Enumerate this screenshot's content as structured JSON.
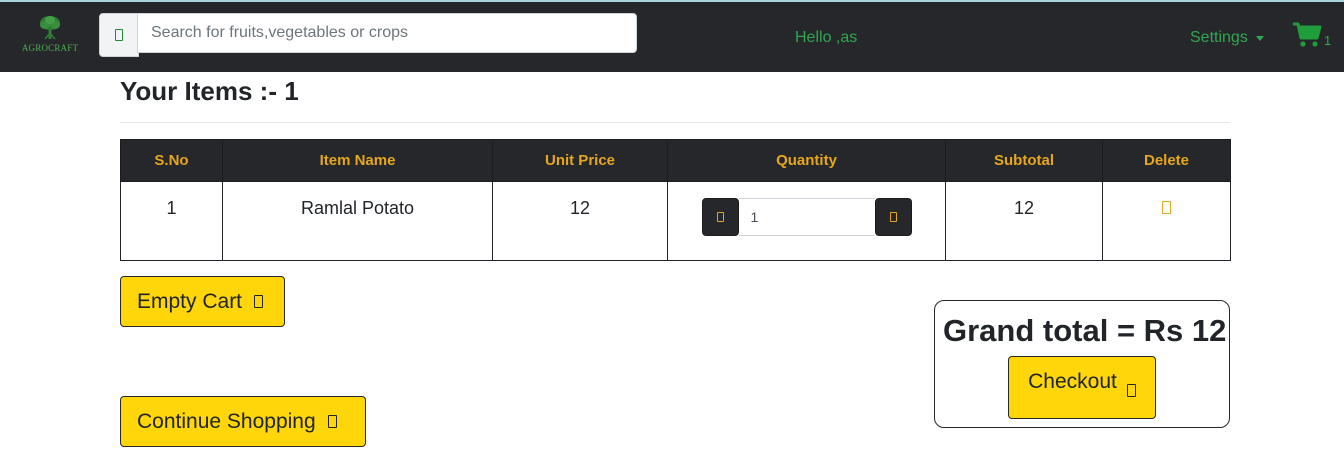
{
  "brand": {
    "name": "AGROCRAFT"
  },
  "search": {
    "placeholder": "Search for fruits,vegetables or crops",
    "icon": "search-icon"
  },
  "nav": {
    "greeting": "Hello ,as",
    "settings_label": "Settings",
    "cart_count": "1"
  },
  "page": {
    "title": "Your Items :- 1"
  },
  "table": {
    "headers": [
      "S.No",
      "Item Name",
      "Unit Price",
      "Quantity",
      "Subtotal",
      "Delete"
    ],
    "rows": [
      {
        "sno": "1",
        "name": "Ramlal Potato",
        "unit_price": "12",
        "quantity": "1",
        "subtotal": "12"
      }
    ]
  },
  "actions": {
    "empty_cart": "Empty Cart",
    "continue_shopping": "Continue Shopping",
    "checkout": "Checkout"
  },
  "summary": {
    "grand_total": "Grand total = Rs 12"
  },
  "colors": {
    "navbar": "#25272a",
    "brand_green": "#2fa84f",
    "header_gold": "#e6a61e",
    "button_yellow": "#ffd60a"
  }
}
